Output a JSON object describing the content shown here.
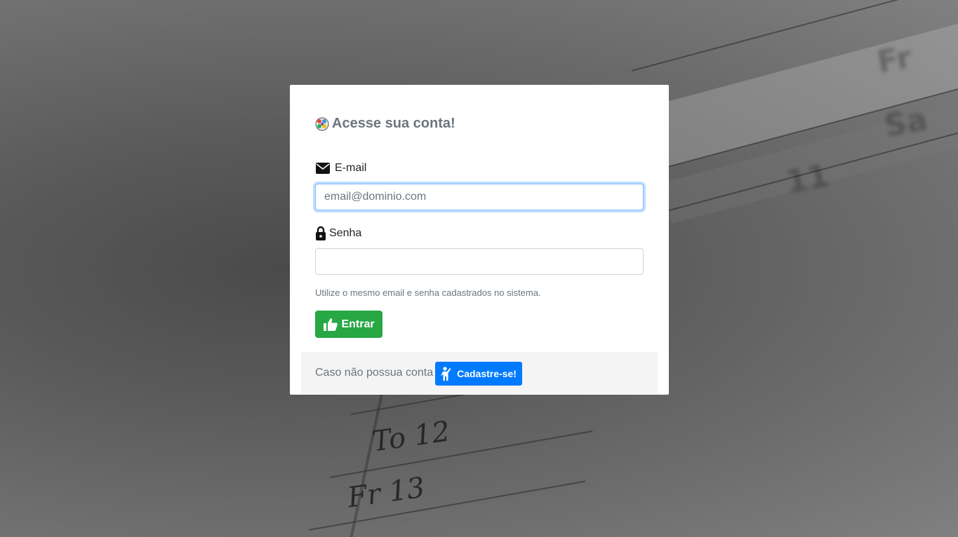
{
  "login_card": {
    "title": "Acesse sua conta!",
    "title_icon": "colorful-grid-logo-icon",
    "email": {
      "label": "E-mail",
      "icon": "envelope-icon",
      "placeholder": "email@dominio.com",
      "value": "",
      "focused": true
    },
    "password": {
      "label": "Senha",
      "icon": "lock-icon",
      "placeholder": "",
      "value": ""
    },
    "help_text": "Utilize o mesmo email e senha cadastrados no sistema.",
    "submit": {
      "label": "Entrar",
      "icon": "thumbs-up-icon",
      "color": "#28a745"
    },
    "footer": {
      "text": "Caso não possua conta",
      "signup_button": {
        "label": "Cadastre-se!",
        "icon": "person-waving-icon",
        "color": "#007bff"
      }
    }
  },
  "background": {
    "calendar_text": [
      "To 12",
      "Fr 13"
    ]
  },
  "colors": {
    "title": "#6c757d",
    "focus_border": "#80bdff",
    "footer_bg": "#f4f4f4"
  }
}
